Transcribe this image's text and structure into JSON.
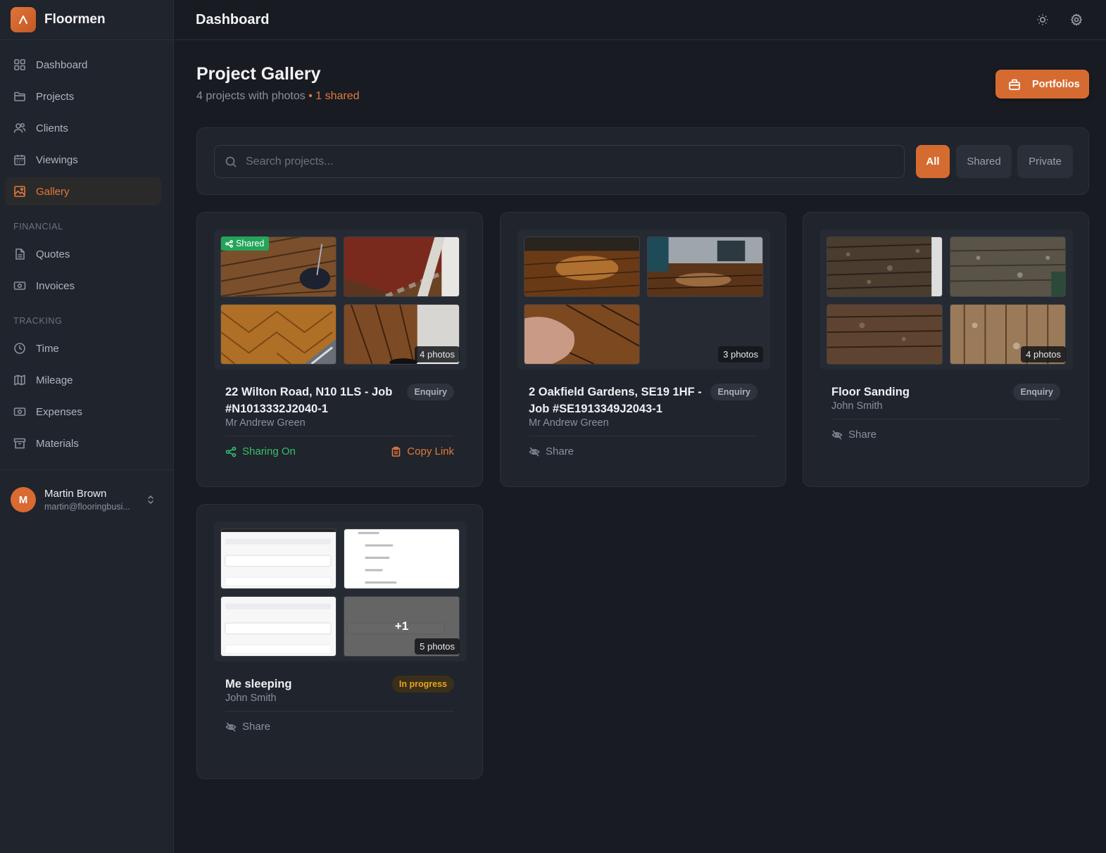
{
  "app": {
    "name": "Floormen"
  },
  "header": {
    "title": "Dashboard"
  },
  "sidebar": {
    "main_items": [
      {
        "label": "Dashboard",
        "icon": "grid-icon"
      },
      {
        "label": "Projects",
        "icon": "folder-icon"
      },
      {
        "label": "Clients",
        "icon": "users-icon"
      },
      {
        "label": "Viewings",
        "icon": "calendar-icon"
      },
      {
        "label": "Gallery",
        "icon": "image-icon",
        "active": true
      }
    ],
    "financial_label": "FINANCIAL",
    "financial_items": [
      {
        "label": "Quotes",
        "icon": "document-icon"
      },
      {
        "label": "Invoices",
        "icon": "banknote-icon"
      }
    ],
    "tracking_label": "TRACKING",
    "tracking_items": [
      {
        "label": "Time",
        "icon": "clock-icon"
      },
      {
        "label": "Mileage",
        "icon": "map-icon"
      },
      {
        "label": "Expenses",
        "icon": "banknote-icon"
      },
      {
        "label": "Materials",
        "icon": "archive-icon"
      }
    ],
    "user": {
      "initial": "M",
      "name": "Martin Brown",
      "email": "martin@flooringbusi..."
    }
  },
  "page": {
    "title": "Project Gallery",
    "subtitle_count": "4 projects with photos",
    "subtitle_sep": " • ",
    "subtitle_shared": "1 shared",
    "portfolios_label": "Portfolios"
  },
  "filters": {
    "search_placeholder": "Search projects...",
    "all": "All",
    "shared": "Shared",
    "private": "Private",
    "active": "All"
  },
  "projects": [
    {
      "title": "22 Wilton Road, N10 1LS - Job #N1013332J2040-1",
      "client": "Mr Andrew Green",
      "status": "Enquiry",
      "photo_count": "4 photos",
      "shared_badge": "Shared",
      "share_label": "Sharing On",
      "copy_label": "Copy Link"
    },
    {
      "title": "2 Oakfield Gardens, SE19 1HF - Job #SE1913349J2043-1",
      "client": "Mr Andrew Green",
      "status": "Enquiry",
      "photo_count": "3 photos",
      "share_label": "Share"
    },
    {
      "title": "Floor Sanding",
      "client": "John Smith",
      "status": "Enquiry",
      "photo_count": "4 photos",
      "share_label": "Share"
    },
    {
      "title": "Me sleeping",
      "client": "John Smith",
      "status": "In progress",
      "photo_count": "5 photos",
      "more_overlay": "+1",
      "share_label": "Share"
    }
  ],
  "colors": {
    "accent": "#d66b31",
    "shared_green": "#23a559",
    "progress_amber": "#e8a325"
  }
}
